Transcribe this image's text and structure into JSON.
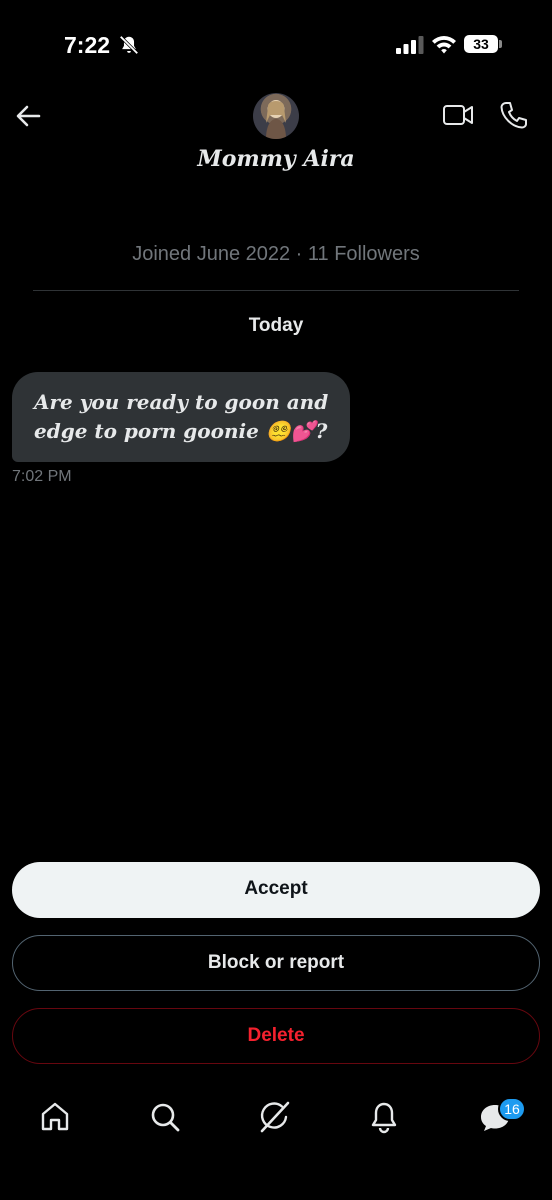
{
  "status_bar": {
    "time": "7:22",
    "battery": "33"
  },
  "header": {
    "contact_name": "Mommy Aira"
  },
  "profile_meta": "Joined June 2022 · 11 Followers",
  "day_separator": "Today",
  "message": {
    "text": "Are you ready to goon and\nedge to porn goonie 😵‍💫💕?",
    "time": "7:02 PM"
  },
  "actions": {
    "accept": "Accept",
    "block_or_report": "Block or report",
    "delete": "Delete"
  },
  "bottom_nav": {
    "messages_badge": "16"
  },
  "colors": {
    "accent": "#1d9bf0",
    "delete": "#f4212e",
    "background": "#000000"
  },
  "icons": [
    "back-arrow-icon",
    "video-call-icon",
    "phone-icon",
    "home-icon",
    "search-icon",
    "grok-icon",
    "bell-icon",
    "messages-icon"
  ]
}
